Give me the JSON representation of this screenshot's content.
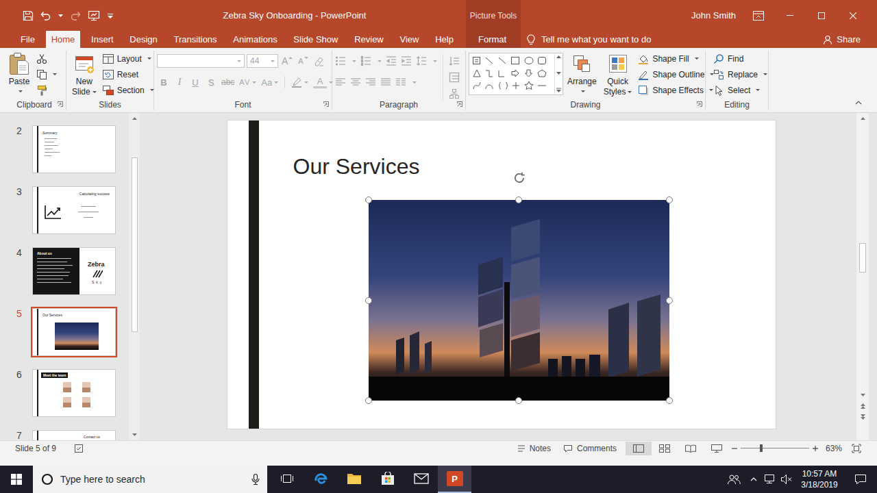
{
  "window": {
    "title": "Zebra Sky Onboarding - PowerPoint",
    "context_group": "Picture Tools",
    "user": "John Smith"
  },
  "tabs": [
    {
      "label": "File",
      "selected": false
    },
    {
      "label": "Home",
      "selected": true
    },
    {
      "label": "Insert",
      "selected": false
    },
    {
      "label": "Design",
      "selected": false
    },
    {
      "label": "Transitions",
      "selected": false
    },
    {
      "label": "Animations",
      "selected": false
    },
    {
      "label": "Slide Show",
      "selected": false
    },
    {
      "label": "Review",
      "selected": false
    },
    {
      "label": "View",
      "selected": false
    },
    {
      "label": "Help",
      "selected": false
    }
  ],
  "context_tab": {
    "label": "Format",
    "selected": false
  },
  "tell_me": "Tell me what you want to do",
  "share": "Share",
  "ribbon": {
    "clipboard": {
      "label": "Clipboard",
      "paste": "Paste"
    },
    "slides": {
      "label": "Slides",
      "new_slide": [
        "New",
        "Slide"
      ],
      "items": [
        "Layout",
        "Reset",
        "Section"
      ]
    },
    "font": {
      "label": "Font",
      "disabled": true,
      "size": "44",
      "size_grow": [
        "A",
        "A"
      ],
      "buttons": [
        {
          "text": "B",
          "kind": "bold"
        },
        {
          "text": "I",
          "kind": "italic"
        },
        {
          "text": "U",
          "kind": "underline"
        },
        {
          "text": "S",
          "kind": "shadow"
        },
        {
          "text": "abc",
          "kind": "strike"
        },
        {
          "text": "AV",
          "kind": "spacing"
        },
        {
          "text": "Aa",
          "kind": "case"
        }
      ],
      "color": "A"
    },
    "paragraph": {
      "label": "Paragraph",
      "disabled": true
    },
    "drawing": {
      "label": "Drawing",
      "arrange": "Arrange",
      "quick_styles": [
        "Quick",
        "Styles"
      ],
      "items": [
        "Shape Fill",
        "Shape Outline",
        "Shape Effects"
      ]
    },
    "editing": {
      "label": "Editing",
      "items": [
        "Find",
        "Replace",
        "Select"
      ]
    }
  },
  "thumbnails": [
    {
      "number": "2",
      "kind": "bullets",
      "title": "Summary",
      "selected": false
    },
    {
      "number": "3",
      "kind": "chart",
      "title": "Calculating success",
      "selected": false
    },
    {
      "number": "4",
      "kind": "about",
      "title": "About us",
      "extra": [
        "Zebra",
        "Sky"
      ],
      "selected": false
    },
    {
      "number": "5",
      "kind": "picture",
      "title": "Our Services",
      "selected": true
    },
    {
      "number": "6",
      "kind": "team",
      "title": "Meet the team",
      "selected": false
    },
    {
      "number": "7",
      "kind": "contact",
      "title": "Contact us",
      "selected": false
    }
  ],
  "slide": {
    "title": "Our Services",
    "picture_selected": true
  },
  "status_bar": {
    "position": "Slide 5 of 9",
    "notes": "Notes",
    "comments": "Comments",
    "views": [
      {
        "kind": "normal",
        "selected": true
      },
      {
        "kind": "sorter",
        "selected": false
      },
      {
        "kind": "reading",
        "selected": false
      },
      {
        "kind": "slideshow",
        "selected": false
      }
    ],
    "zoom": "63%",
    "zoom_level": 0.3
  },
  "taskbar": {
    "search": "Type here to search",
    "apps": [
      {
        "kind": "task-view",
        "active": false
      },
      {
        "kind": "edge",
        "active": false
      },
      {
        "kind": "explorer",
        "active": false
      },
      {
        "kind": "store",
        "active": false
      },
      {
        "kind": "mail",
        "active": false
      },
      {
        "kind": "powerpoint",
        "active": true,
        "glyph": "P"
      }
    ],
    "volume_muted": true,
    "time": "10:57 AM",
    "date": "3/18/2019"
  }
}
